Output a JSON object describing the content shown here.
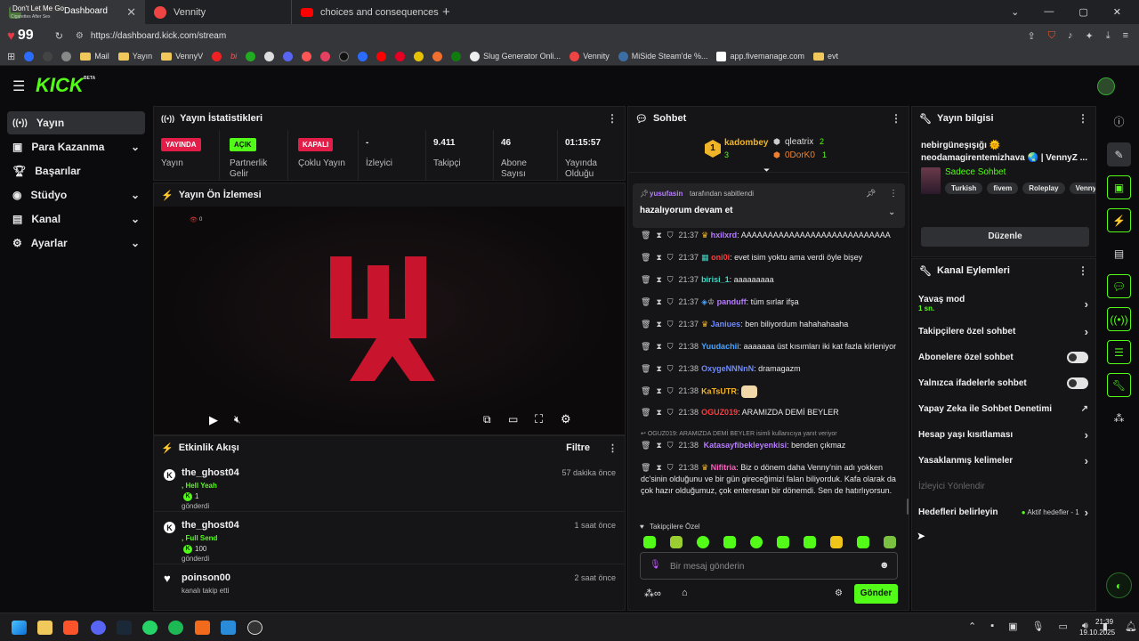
{
  "tabs": [
    {
      "title": "Dashboard",
      "sub_title": "Don't Let Me Go",
      "sub_small": "Cigarettes After Sex",
      "active": true
    },
    {
      "title": "Vennity",
      "active": false
    },
    {
      "title": "choices and consequences - VennyZ",
      "active": false
    }
  ],
  "browser": {
    "score": "99",
    "url": "https://dashboard.kick.com/stream"
  },
  "bookmarks": [
    "Mail",
    "Yayın",
    "VennyV",
    "bi",
    "Slug Generator Onli...",
    "Vennity",
    "MiSide Steam'de %...",
    "app.fivemanage.com",
    "evt"
  ],
  "brand": {
    "logo": "KICK",
    "beta": "BETA",
    "green": "#53fc18"
  },
  "nav": [
    {
      "label": "Yayın",
      "active": true,
      "icon": "broadcast-icon",
      "chev": false
    },
    {
      "label": "Para Kazanma",
      "active": false,
      "icon": "wallet-icon",
      "chev": true
    },
    {
      "label": "Başarılar",
      "active": false,
      "icon": "trophy-icon",
      "chev": false
    },
    {
      "label": "Stüdyo",
      "active": false,
      "icon": "studio-icon",
      "chev": true
    },
    {
      "label": "Kanal",
      "active": false,
      "icon": "channel-icon",
      "chev": true
    },
    {
      "label": "Ayarlar",
      "active": false,
      "icon": "gear-icon",
      "chev": true
    }
  ],
  "stats": {
    "title": "Yayın İstatistikleri",
    "items": [
      {
        "value": "YAYINDA",
        "label": "Yayın",
        "badge": "red"
      },
      {
        "value": "AÇIK",
        "label": "Partnerlik Gelir",
        "badge": "green"
      },
      {
        "value": "KAPALI",
        "label": "Çoklu Yayın",
        "badge": "red"
      },
      {
        "value": "-",
        "label": "İzleyici"
      },
      {
        "value": "9.411",
        "label": "Takipçi"
      },
      {
        "value": "46",
        "label": "Abone Sayısı"
      },
      {
        "value": "01:15:57",
        "label": "Yayında Olduğu"
      }
    ]
  },
  "preview": {
    "title": "Yayın Ön İzlemesi",
    "viewers": "0"
  },
  "events": {
    "title": "Etkinlik Akışı",
    "filter": "Filtre",
    "items": [
      {
        "user": "the_ghost04",
        "detail": ", Hell Yeah",
        "amount": "1",
        "action": "gönderdi",
        "time": "57 dakika önce"
      },
      {
        "user": "the_ghost04",
        "detail": ", Full Send",
        "amount": "100",
        "action": "gönderdi",
        "time": "1 saat önce"
      },
      {
        "user": "poinson00",
        "detail": "",
        "amount": "",
        "action": "kanalı takip etti",
        "time": "2 saat önce"
      }
    ]
  },
  "chat": {
    "title": "Sohbet",
    "top": [
      {
        "rank": "1",
        "name": "kadombey",
        "count": "3"
      },
      {
        "name": "qleatrix",
        "count": "2"
      },
      {
        "name": "0DorK0",
        "count": "1"
      }
    ],
    "pinned": {
      "by": "yusufasin",
      "by_suffix": "tarafından sabitlendi",
      "text": "hazalıyorum devam et"
    },
    "messages": [
      {
        "time": "21:37",
        "user": "hxilxrd",
        "color": "#b67cff",
        "text": "AAAAAAAAAAAAAAAAAAAAAAAAAAAA"
      },
      {
        "time": "21:37",
        "user": "oni0i",
        "color": "#ff3b3b",
        "text": "evet isim yoktu ama verdi öyle bişey"
      },
      {
        "time": "21:37",
        "user": "birisi_1",
        "color": "#3dd9c5",
        "text": "aaaaaaaaa"
      },
      {
        "time": "21:37",
        "user": "panduff",
        "color": "#b67cff",
        "text": "tüm sırlar ifşa"
      },
      {
        "time": "21:37",
        "user": "Janiues",
        "color": "#6f8bff",
        "text": "ben biliyordum hahahahaaha"
      },
      {
        "time": "21:38",
        "user": "Yuudachii",
        "color": "#4aa3ff",
        "text": "aaaaaaa üst kısımları iki kat fazla kirleniyor"
      },
      {
        "time": "21:38",
        "user": "OxygeNNNnN",
        "color": "#6f8bff",
        "text": "dramagazm"
      },
      {
        "time": "21:38",
        "user": "KaTsUTR",
        "color": "#f0c419",
        "text": ""
      },
      {
        "time": "21:38",
        "user": "OGUZ019",
        "color": "#ff3b3b",
        "text": "ARAMIZDA DEMİ BEYLER"
      },
      {
        "time": "21:38",
        "user": "Katasayfibekleyenkisi",
        "color": "#b67cff",
        "text": "benden çıkmaz",
        "reply": "OGUZ019: ARAMIZDA DEMİ BEYLER isimli kullanıcıya yanıt veriyor"
      },
      {
        "time": "21:38",
        "user": "Nifitria",
        "color": "#ff5bbd",
        "text": "Biz o dönem daha Venny'nin adı yokken dc'sinin olduğunu ve bir gün gireceğimizi falan biliyorduk. Kafa olarak da çok hazır olduğumuz, çok enteresan bir dönemdi. Sen de hatırlıyorsun."
      }
    ],
    "followers_only": "Takipçilere Özel",
    "placeholder": "Bir mesaj gönderin",
    "send": "Gönder"
  },
  "info": {
    "title": "Yayın bilgisi",
    "stream_title": "nebirgüneşışığı 🌞 neodamagirentemizhava 🌏 | VennyZ ...",
    "category": "Sadece Sohbet",
    "tags": [
      "Turkish",
      "fivem",
      "Roleplay",
      "Venny"
    ],
    "edit": "Düzenle"
  },
  "actions": {
    "title": "Kanal Eylemleri",
    "items": [
      {
        "label": "Yavaş mod",
        "sub": "1 sn.",
        "type": "chev"
      },
      {
        "label": "Takipçilere özel sohbet",
        "type": "chev"
      },
      {
        "label": "Abonelere özel sohbet",
        "type": "toggle"
      },
      {
        "label": "Yalnızca ifadelerle sohbet",
        "type": "toggle"
      },
      {
        "label": "Yapay Zeka ile Sohbet Denetimi",
        "type": "ext"
      },
      {
        "label": "Hesap yaşı kısıtlaması",
        "type": "chev"
      },
      {
        "label": "Yasaklanmış kelimeler",
        "type": "chev"
      },
      {
        "label": "İzleyici Yönlendir",
        "type": "none",
        "dim": true
      },
      {
        "label": "Hedefleri belirleyin",
        "type": "chev",
        "status": "Aktif hedefler - 1"
      }
    ]
  },
  "clock": {
    "time": "21:39",
    "date": "19.10.2025"
  }
}
